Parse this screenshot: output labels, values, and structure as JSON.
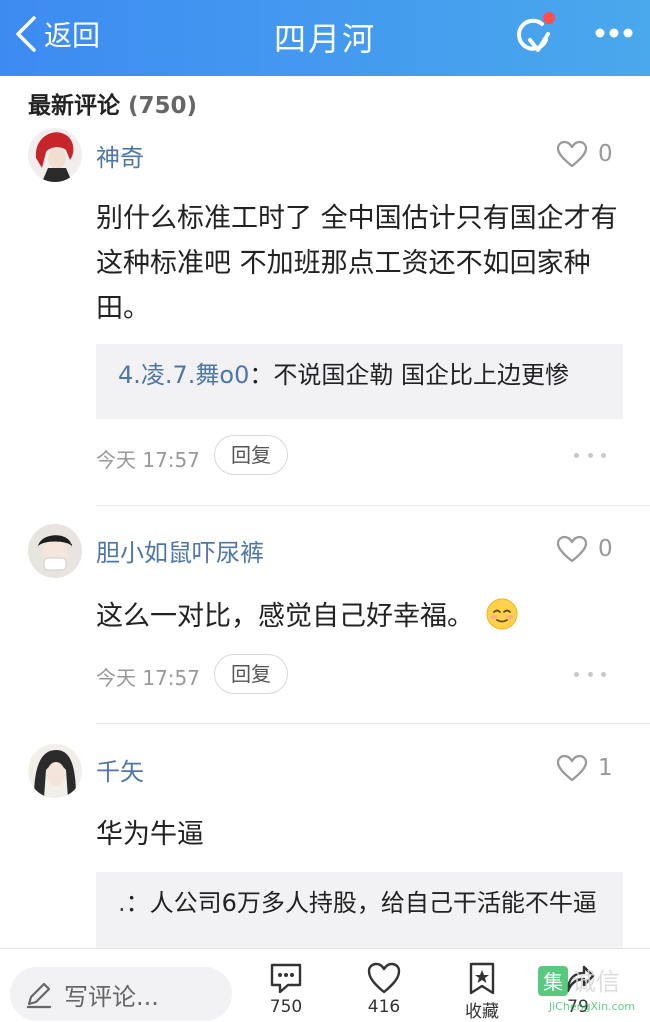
{
  "header": {
    "back_label": "返回",
    "title": "四月河",
    "back_icon": "chevron-left-icon",
    "refresh_icon": "refresh-icon",
    "more_icon": "more-icon"
  },
  "section": {
    "title": "最新评论",
    "count": "(750)"
  },
  "comments": [
    {
      "username": "神奇",
      "likes": "0",
      "text": "别什么标准工时了 全中国估计只有国企才有这种标准吧 不加班那点工资还不如回家种田。",
      "reply": {
        "name": "4.凌.7.舞o0",
        "sep": "：",
        "text": "不说国企勒  国企比上边更惨"
      },
      "time": "今天 17:57",
      "reply_label": "回复"
    },
    {
      "username": "胆小如鼠吓尿裤",
      "likes": "0",
      "text": "这么一对比，感觉自己好幸福。",
      "time": "今天 17:57",
      "reply_label": "回复"
    },
    {
      "username": "千矢",
      "likes": "1",
      "text": "华为牛逼",
      "reply": {
        "name": ".",
        "sep": "：",
        "text": "人公司6万多人持股，给自己干活能不牛逼"
      }
    }
  ],
  "bottom_bar": {
    "input_placeholder": "写评论...",
    "comments_count": "750",
    "likes_count": "416",
    "favorite_label": "收藏",
    "share_count": "79"
  },
  "watermark": {
    "text": "JiChengXin.com"
  },
  "colors": {
    "header_start": "#3d8bf2",
    "header_end": "#4aa8ec",
    "username": "#4d77a8",
    "notification_dot": "#ff4d4d"
  }
}
